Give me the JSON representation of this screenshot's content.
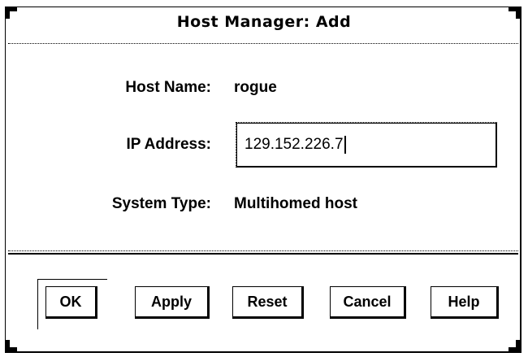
{
  "dialog": {
    "title": "Host Manager: Add"
  },
  "form": {
    "host_name_label": "Host Name:",
    "host_name_value": "rogue",
    "ip_address_label": "IP Address:",
    "ip_address_value": "129.152.226.7",
    "system_type_label": "System Type:",
    "system_type_value": "Multihomed host"
  },
  "buttons": {
    "ok": "OK",
    "apply": "Apply",
    "reset": "Reset",
    "cancel": "Cancel",
    "help": "Help"
  }
}
